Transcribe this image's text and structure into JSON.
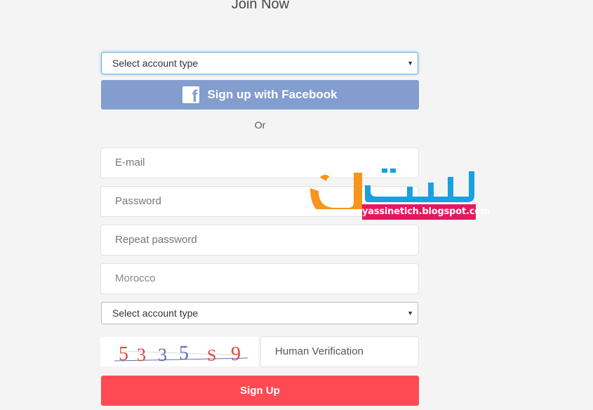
{
  "page": {
    "title": "Join Now"
  },
  "account_select_top": {
    "value": "Select account type",
    "arrow": "▼"
  },
  "facebook": {
    "label": "Sign up with Facebook",
    "icon": "facebook-icon",
    "color": "#829dce"
  },
  "divider": {
    "label": "Or"
  },
  "fields": {
    "email": "E-mail",
    "password": "Password",
    "repeat_password": "Repeat password",
    "country": "Morocco"
  },
  "account_select_bottom": {
    "value": "Select account type",
    "arrow": "▼"
  },
  "captcha": {
    "digits": [
      "5",
      "3",
      "3",
      "5",
      "S",
      "9"
    ],
    "text": "533559"
  },
  "human_verification": {
    "placeholder": "Human Verification"
  },
  "signup": {
    "label": "Sign Up",
    "color": "#ff4a53"
  },
  "watermark": {
    "text_arabic": "ياسين تك",
    "url": "yassinetich.blogspot.com"
  }
}
